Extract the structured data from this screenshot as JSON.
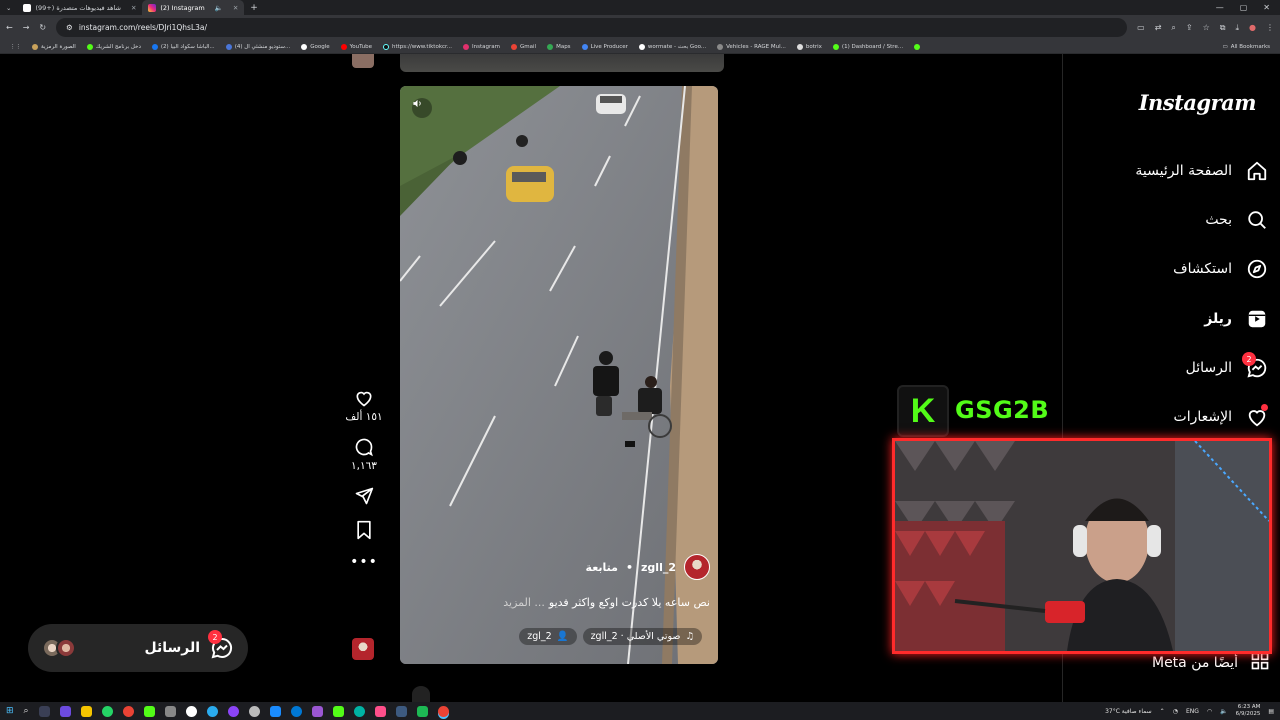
{
  "browser": {
    "tabs": [
      {
        "title": "(99+) شاهد فيديوهات متصدرة",
        "active": false
      },
      {
        "title": "(2) Instagram",
        "active": true
      }
    ],
    "url": "instagram.com/reels/DJri1QhsL3a/",
    "bookmarks": [
      "الصورة الرمزية",
      "دخل برنامج الشريك",
      "(2) الباشا سكواد البيا...",
      "(4) ستوديو منشئي ال...",
      "Google",
      "YouTube",
      "https://www.tiktokcr...",
      "Instagram",
      "Gmail",
      "Maps",
      "Live Producer",
      "wormate - بحث Goo...",
      "Vehicles - RAGE Mul...",
      "botrix",
      "(1) Dashboard / Stre..."
    ],
    "all_bookmarks": "All Bookmarks"
  },
  "nav": {
    "logo": "Instagram",
    "items": [
      {
        "label": "الصفحة الرئيسية",
        "icon": "home-icon"
      },
      {
        "label": "بحث",
        "icon": "search-icon"
      },
      {
        "label": "استكشاف",
        "icon": "explore-icon"
      },
      {
        "label": "ريلز",
        "icon": "reels-icon"
      },
      {
        "label": "الرسائل",
        "icon": "messenger-icon",
        "badge": "2"
      },
      {
        "label": "الإشعارات",
        "icon": "heart-icon"
      }
    ],
    "meta": "أيضًا من Meta"
  },
  "reel": {
    "author": "2_zgll",
    "follow": "متابعة",
    "caption": "نص ساعه يلا كدرت اوكع واكثر فديو",
    "more": "... المزيد",
    "audio": "صوتي الأصلي · 2_zgll",
    "tagged": "2_zgl",
    "likes": "١٥١ ألف",
    "comments": "١,١٦٣"
  },
  "messages_pill": {
    "label": "الرسائل",
    "badge": "2"
  },
  "overlay": {
    "brand": "GSG2B",
    "accent": "#53fc18",
    "frame": "#ff2b2b"
  },
  "taskbar": {
    "weather": "37°C  سماء صافية",
    "lang": "ENG",
    "time": "6:23 AM",
    "date": "6/9/2025"
  }
}
